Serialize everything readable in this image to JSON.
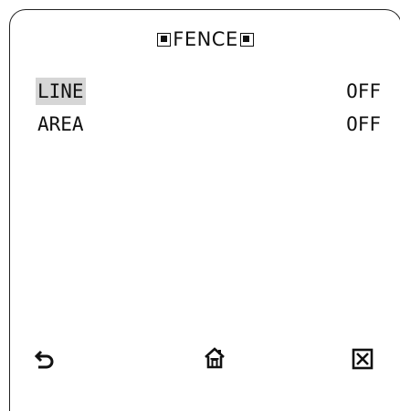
{
  "menu": {
    "title": "FENCE",
    "items": [
      {
        "label": "LINE",
        "value": "OFF",
        "selected": true
      },
      {
        "label": "AREA",
        "value": "OFF",
        "selected": false
      }
    ]
  },
  "footer": {
    "back_icon": "back-arrow-icon",
    "home_icon": "home-icon",
    "close_icon": "close-box-icon"
  }
}
